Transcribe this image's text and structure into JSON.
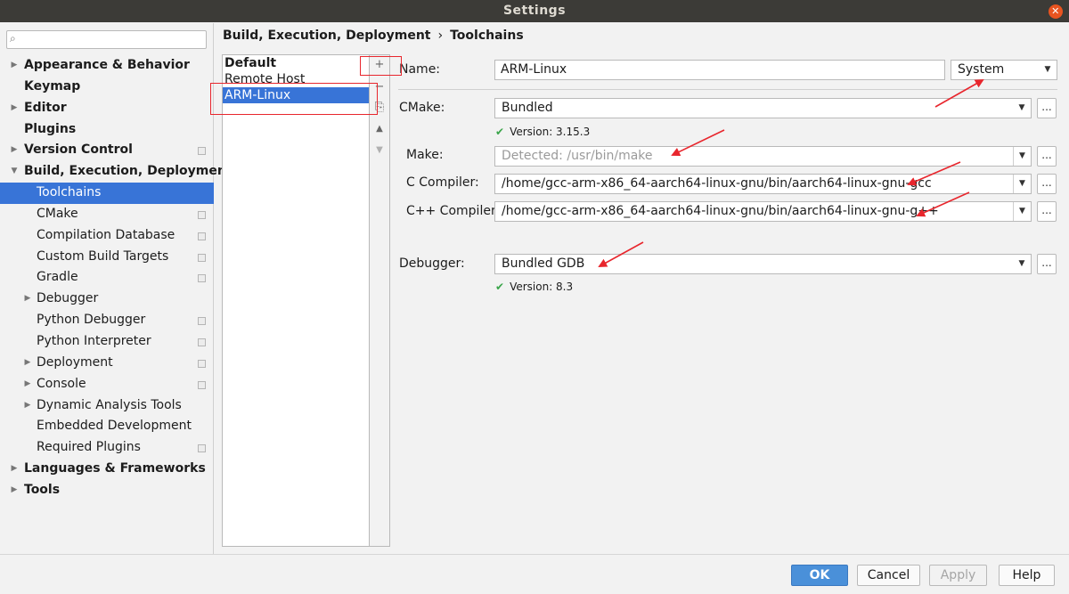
{
  "window": {
    "title": "Settings"
  },
  "search": {
    "placeholder": ""
  },
  "tree": [
    {
      "label": "Appearance & Behavior",
      "level": 0,
      "expandable": true,
      "expanded": false
    },
    {
      "label": "Keymap",
      "level": 0,
      "expandable": false
    },
    {
      "label": "Editor",
      "level": 0,
      "expandable": true,
      "expanded": false
    },
    {
      "label": "Plugins",
      "level": 0,
      "expandable": false
    },
    {
      "label": "Version Control",
      "level": 0,
      "expandable": true,
      "expanded": false,
      "project": true
    },
    {
      "label": "Build, Execution, Deployment",
      "level": 0,
      "expandable": true,
      "expanded": true
    },
    {
      "label": "Toolchains",
      "level": 1,
      "selected": true
    },
    {
      "label": "CMake",
      "level": 1,
      "project": true
    },
    {
      "label": "Compilation Database",
      "level": 1,
      "project": true
    },
    {
      "label": "Custom Build Targets",
      "level": 1,
      "project": true
    },
    {
      "label": "Gradle",
      "level": 1,
      "project": true
    },
    {
      "label": "Debugger",
      "level": 1,
      "expandable": true,
      "expanded": false
    },
    {
      "label": "Python Debugger",
      "level": 1,
      "project": true
    },
    {
      "label": "Python Interpreter",
      "level": 1,
      "project": true
    },
    {
      "label": "Deployment",
      "level": 1,
      "expandable": true,
      "expanded": false,
      "project": true
    },
    {
      "label": "Console",
      "level": 1,
      "expandable": true,
      "expanded": false,
      "project": true
    },
    {
      "label": "Dynamic Analysis Tools",
      "level": 1,
      "expandable": true,
      "expanded": false
    },
    {
      "label": "Embedded Development",
      "level": 1
    },
    {
      "label": "Required Plugins",
      "level": 1,
      "project": true
    },
    {
      "label": "Languages & Frameworks",
      "level": 0,
      "expandable": true,
      "expanded": false
    },
    {
      "label": "Tools",
      "level": 0,
      "expandable": true,
      "expanded": false
    }
  ],
  "breadcrumb": {
    "parent": "Build, Execution, Deployment",
    "separator": "›",
    "current": "Toolchains"
  },
  "toolchains": {
    "items": [
      {
        "label": "Default",
        "bold": true
      },
      {
        "label": "Remote Host"
      },
      {
        "label": "ARM-Linux",
        "selected": true
      }
    ],
    "tools": {
      "add": "+",
      "remove": "−",
      "copy": "⎘",
      "up": "▲",
      "down": "▼"
    }
  },
  "form": {
    "name_label": "Name:",
    "name_value": "ARM-Linux",
    "env_value": "System",
    "cmake_label": "CMake:",
    "cmake_value": "Bundled",
    "cmake_version": "Version: 3.15.3",
    "make_label": "Make:",
    "make_placeholder": "Detected: /usr/bin/make",
    "cc_label": "C Compiler:",
    "cc_value": "/home/gcc-arm-x86_64-aarch64-linux-gnu/bin/aarch64-linux-gnu-gcc",
    "cxx_label": "C++ Compiler:",
    "cxx_value": "/home/gcc-arm-x86_64-aarch64-linux-gnu/bin/aarch64-linux-gnu-g++",
    "debugger_label": "Debugger:",
    "debugger_value": "Bundled GDB",
    "debugger_version": "Version: 8.3",
    "browse": "..."
  },
  "buttons": {
    "ok": "OK",
    "cancel": "Cancel",
    "apply": "Apply",
    "help": "Help"
  },
  "colors": {
    "selection": "#3874d7",
    "annotation": "#e8262d",
    "check": "#3aa54a",
    "primary": "#4a90d9"
  }
}
